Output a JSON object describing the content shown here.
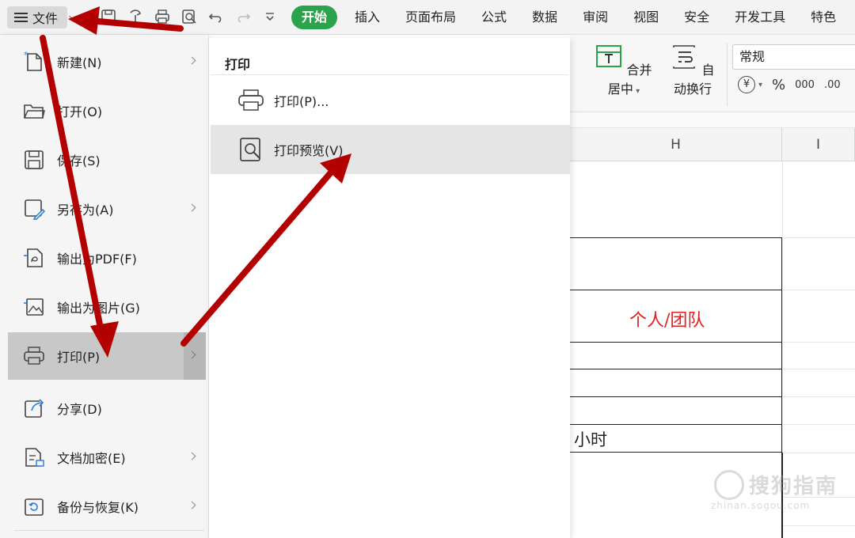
{
  "menubar": {
    "file_label": "文件",
    "tabs": [
      {
        "label": "开始",
        "active": true
      },
      {
        "label": "插入"
      },
      {
        "label": "页面布局"
      },
      {
        "label": "公式"
      },
      {
        "label": "数据"
      },
      {
        "label": "审阅"
      },
      {
        "label": "视图"
      },
      {
        "label": "安全"
      },
      {
        "label": "开发工具"
      },
      {
        "label": "特色"
      }
    ],
    "quick_access_icons": [
      "save-icon",
      "format-painter-icon",
      "print-icon",
      "print-preview-icon",
      "undo-icon",
      "redo-icon",
      "customize-icon"
    ]
  },
  "ribbon": {
    "merge_center_label": "合并居中",
    "wrap_text_label": "自动换行",
    "number_format_value": "常规",
    "currency_symbol": "¥",
    "percent_symbol": "%",
    "thousands_symbol": "000",
    "decimal_symbol": ".00"
  },
  "file_menu": {
    "items": [
      {
        "label": "新建(N)",
        "icon": "new-file-icon",
        "has_submenu": true
      },
      {
        "label": "打开(O)",
        "icon": "folder-open-icon",
        "has_submenu": false
      },
      {
        "label": "保存(S)",
        "icon": "save-icon",
        "has_submenu": false
      },
      {
        "label": "另存为(A)",
        "icon": "save-as-icon",
        "has_submenu": true
      },
      {
        "label": "输出为PDF(F)",
        "icon": "pdf-export-icon",
        "has_submenu": false
      },
      {
        "label": "输出为图片(G)",
        "icon": "image-export-icon",
        "has_submenu": false
      },
      {
        "label": "打印(P)",
        "icon": "printer-icon",
        "has_submenu": true,
        "active": true
      },
      {
        "label": "分享(D)",
        "icon": "share-icon",
        "has_submenu": false
      },
      {
        "label": "文档加密(E)",
        "icon": "encrypt-doc-icon",
        "has_submenu": true
      },
      {
        "label": "备份与恢复(K)",
        "icon": "backup-restore-icon",
        "has_submenu": true
      }
    ]
  },
  "print_submenu": {
    "title": "打印",
    "items": [
      {
        "label": "打印(P)...",
        "icon": "printer-icon"
      },
      {
        "label": "打印预览(V)",
        "icon": "print-preview-icon",
        "hover": true
      }
    ]
  },
  "sheet": {
    "columns": [
      "H",
      "I"
    ],
    "cells": {
      "team_label": "个人/团队",
      "hours_label": "小时"
    }
  },
  "watermark": {
    "main": "搜狗指南",
    "sub": "zhinan.sogou.com"
  },
  "colors": {
    "accent_green": "#2ba24c",
    "annotation_red": "#b30000",
    "team_text_red": "#e02020"
  }
}
